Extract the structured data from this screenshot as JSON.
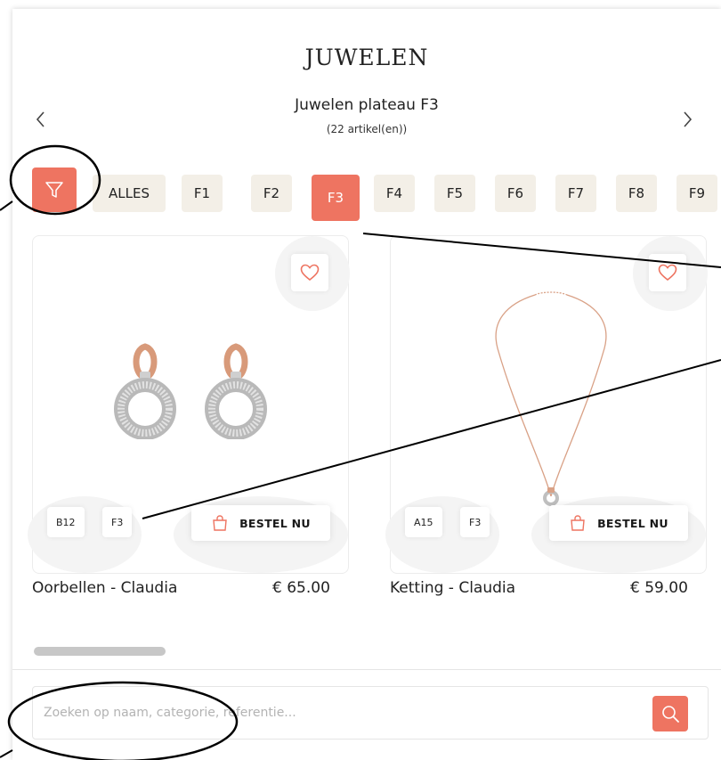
{
  "header": {
    "title": "JUWELEN",
    "subtitle": "Juwelen plateau F3",
    "count": "(22 artikel(en))"
  },
  "tabs": [
    {
      "label": "ALLES",
      "active": false
    },
    {
      "label": "F1",
      "active": false
    },
    {
      "label": "F2",
      "active": false
    },
    {
      "label": "F3",
      "active": true
    },
    {
      "label": "F4",
      "active": false
    },
    {
      "label": "F5",
      "active": false
    },
    {
      "label": "F6",
      "active": false
    },
    {
      "label": "F7",
      "active": false
    },
    {
      "label": "F8",
      "active": false
    },
    {
      "label": "F9",
      "active": false
    }
  ],
  "products": [
    {
      "name": "Oorbellen - Claudia",
      "price": "€ 65.00",
      "location_code": "B12",
      "plateau": "F3",
      "order_label": "BESTEL NU"
    },
    {
      "name": "Ketting - Claudia",
      "price": "€ 59.00",
      "location_code": "A15",
      "plateau": "F3",
      "order_label": "BESTEL NU"
    }
  ],
  "search": {
    "placeholder": "Zoeken op naam, categorie, referentie...",
    "value": ""
  },
  "icons": {
    "filter": "filter-icon",
    "prev": "chevron-left-icon",
    "next": "chevron-right-icon",
    "favorite": "heart-icon",
    "bag": "shopping-bag-icon",
    "search": "search-icon"
  },
  "colors": {
    "accent": "#ee7461",
    "tab_bg": "#f3efe7",
    "text": "#222222"
  }
}
